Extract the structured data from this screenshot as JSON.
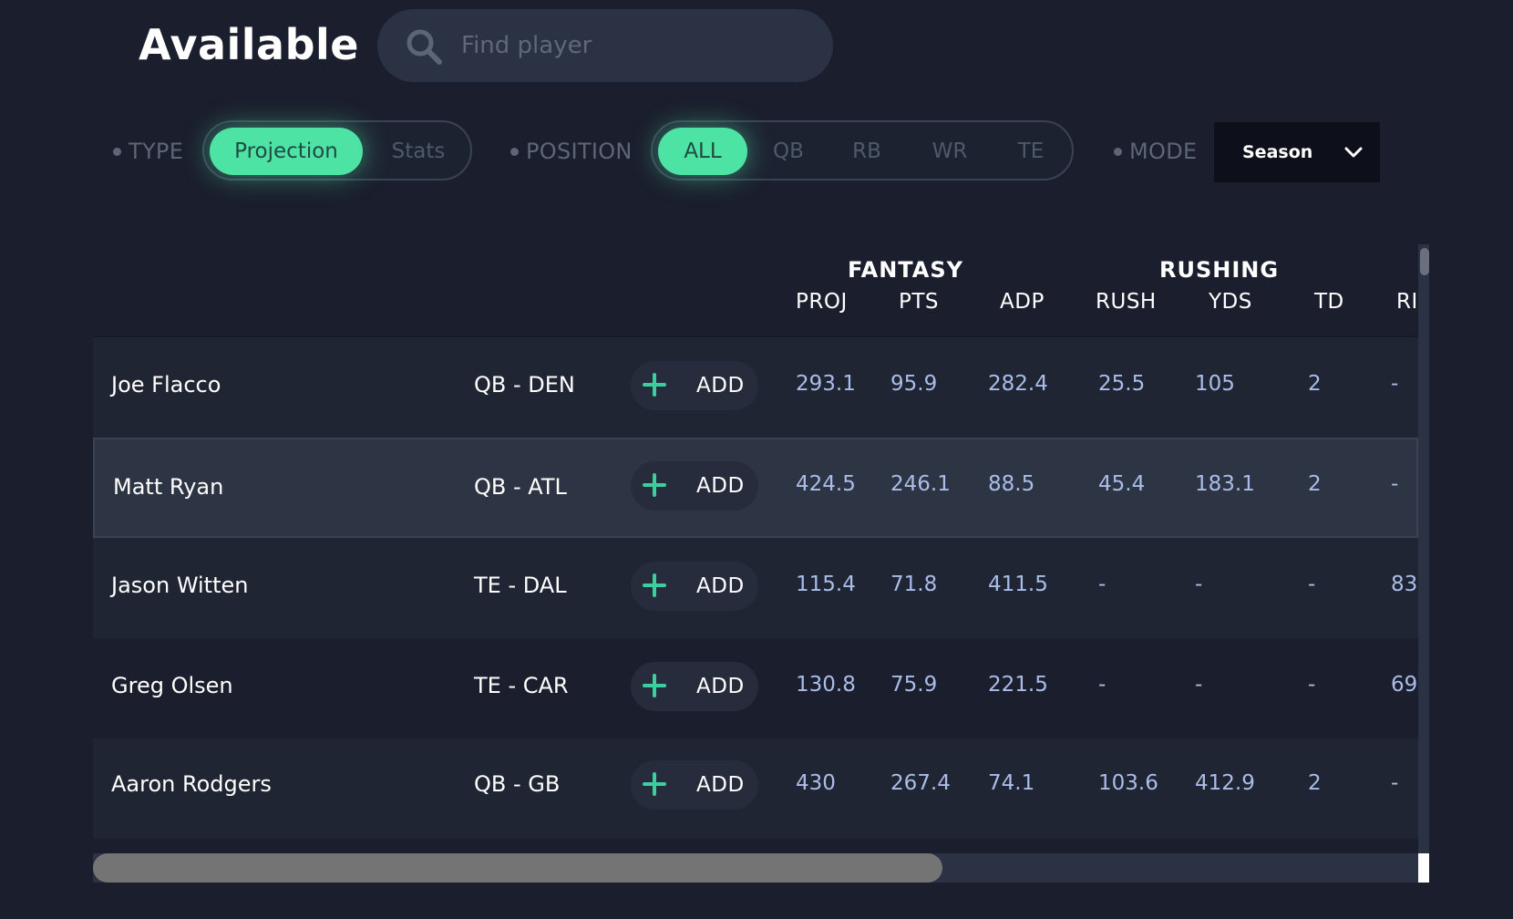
{
  "header": {
    "title": "Available",
    "search": {
      "placeholder": "Find player",
      "value": "",
      "icon": "search-icon"
    }
  },
  "filters": {
    "type": {
      "label": "TYPE",
      "options": [
        "Projection",
        "Stats"
      ],
      "selected": "Projection"
    },
    "position": {
      "label": "POSITION",
      "options": [
        "ALL",
        "QB",
        "RB",
        "WR",
        "TE"
      ],
      "selected": "ALL"
    },
    "mode": {
      "label": "MODE",
      "value": "Season",
      "icon": "chevron-down-icon"
    }
  },
  "table": {
    "group_headers": [
      "FANTASY",
      "RUSHING"
    ],
    "columns": [
      "PROJ",
      "PTS",
      "ADP",
      "RUSH",
      "YDS",
      "TD",
      "RI"
    ],
    "add_label": "ADD",
    "rows": [
      {
        "name": "Joe Flacco",
        "position": "QB - DEN",
        "values": [
          "293.1",
          "95.9",
          "282.4",
          "25.5",
          "105",
          "2",
          "-"
        ]
      },
      {
        "name": "Matt Ryan",
        "position": "QB - ATL",
        "values": [
          "424.5",
          "246.1",
          "88.5",
          "45.4",
          "183.1",
          "2",
          "-"
        ]
      },
      {
        "name": "Jason Witten",
        "position": "TE - DAL",
        "values": [
          "115.4",
          "71.8",
          "411.5",
          "-",
          "-",
          "-",
          "83"
        ]
      },
      {
        "name": "Greg Olsen",
        "position": "TE - CAR",
        "values": [
          "130.8",
          "75.9",
          "221.5",
          "-",
          "-",
          "-",
          "69"
        ]
      },
      {
        "name": "Aaron Rodgers",
        "position": "QB - GB",
        "values": [
          "430",
          "267.4",
          "74.1",
          "103.6",
          "412.9",
          "2",
          "-"
        ]
      }
    ]
  },
  "colors": {
    "background": "#1b1f2d",
    "accent": "#4de3a4",
    "value_text": "#a9bde8",
    "plus": "#3ccf9e"
  }
}
